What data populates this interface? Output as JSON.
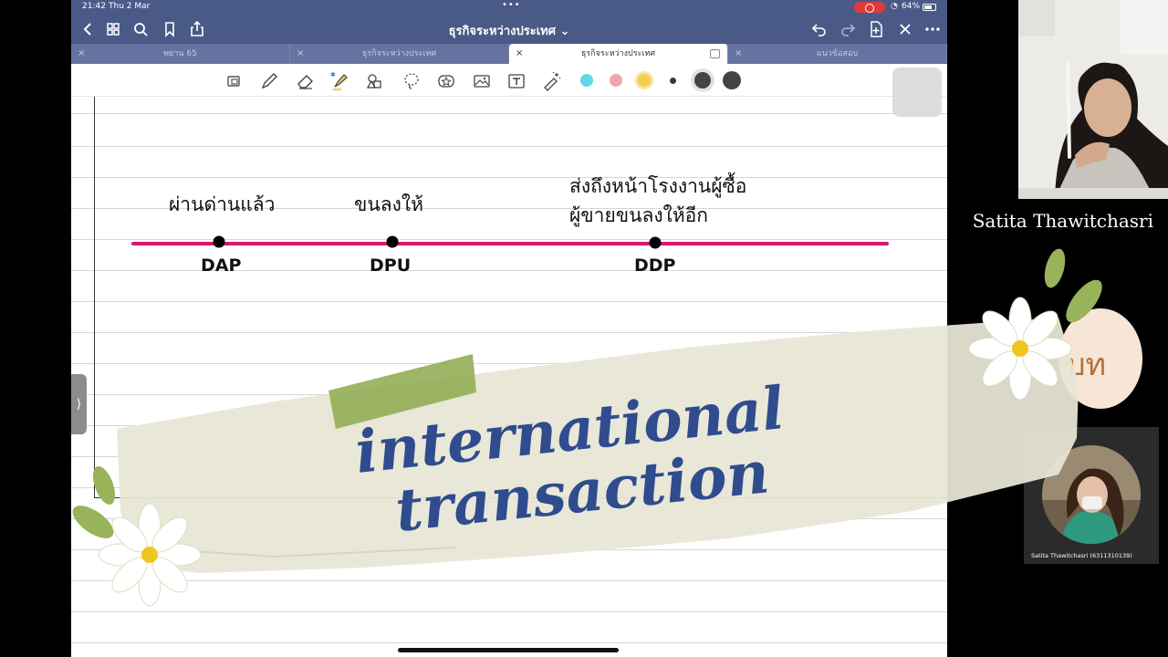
{
  "status_bar": {
    "time": "21:42",
    "date": "Thu 2 Mar",
    "battery": "64%"
  },
  "nav": {
    "title": "ธุรกิจระหว่างประเทศ ⌄",
    "icons": [
      "back-icon",
      "grid-icon",
      "search-icon",
      "bookmark-icon",
      "share-icon",
      "undo-icon",
      "redo-icon",
      "add-page-icon",
      "close-icon",
      "more-icon"
    ]
  },
  "tabs": [
    {
      "label": "พยาน 65",
      "active": false
    },
    {
      "label": "ธุรกิจระหว่างประเทศ",
      "active": false
    },
    {
      "label": "ธุรกิจระหว่างประเทศ",
      "active": true
    },
    {
      "label": "แนวข้อสอบ",
      "active": false
    }
  ],
  "toolbar": {
    "tools": [
      "zoom-icon",
      "pen-icon",
      "eraser-icon",
      "highlighter-icon",
      "shapes-icon",
      "lasso-icon",
      "sticker-icon",
      "image-icon",
      "text-icon",
      "laser-icon"
    ],
    "colors": [
      "#5fd8ea",
      "#f2a5ab",
      "#f1cf4d",
      "#3a3a3a",
      "#444444",
      "#444444"
    ]
  },
  "notes": {
    "term1_label": "ผ่านด่านแล้ว",
    "term2_label": "ขนลงให้",
    "term3_label_line1": "ส่งถึงหน้าโรงงานผู้ซื้อ",
    "term3_label_line2": "ผู้ขายขนลงให้อีก",
    "term1": "DAP",
    "term2": "DPU",
    "term3": "DDP",
    "line_color": "#d31a6d"
  },
  "banner": {
    "line1": "international",
    "line2": "transaction",
    "color": "#2f4c8e"
  },
  "side_overlay": {
    "text": "บท"
  },
  "speaker": {
    "name": "Satita Thawitchasri"
  },
  "participant": {
    "label": "Satita Thawitchasri (6311310139)"
  }
}
